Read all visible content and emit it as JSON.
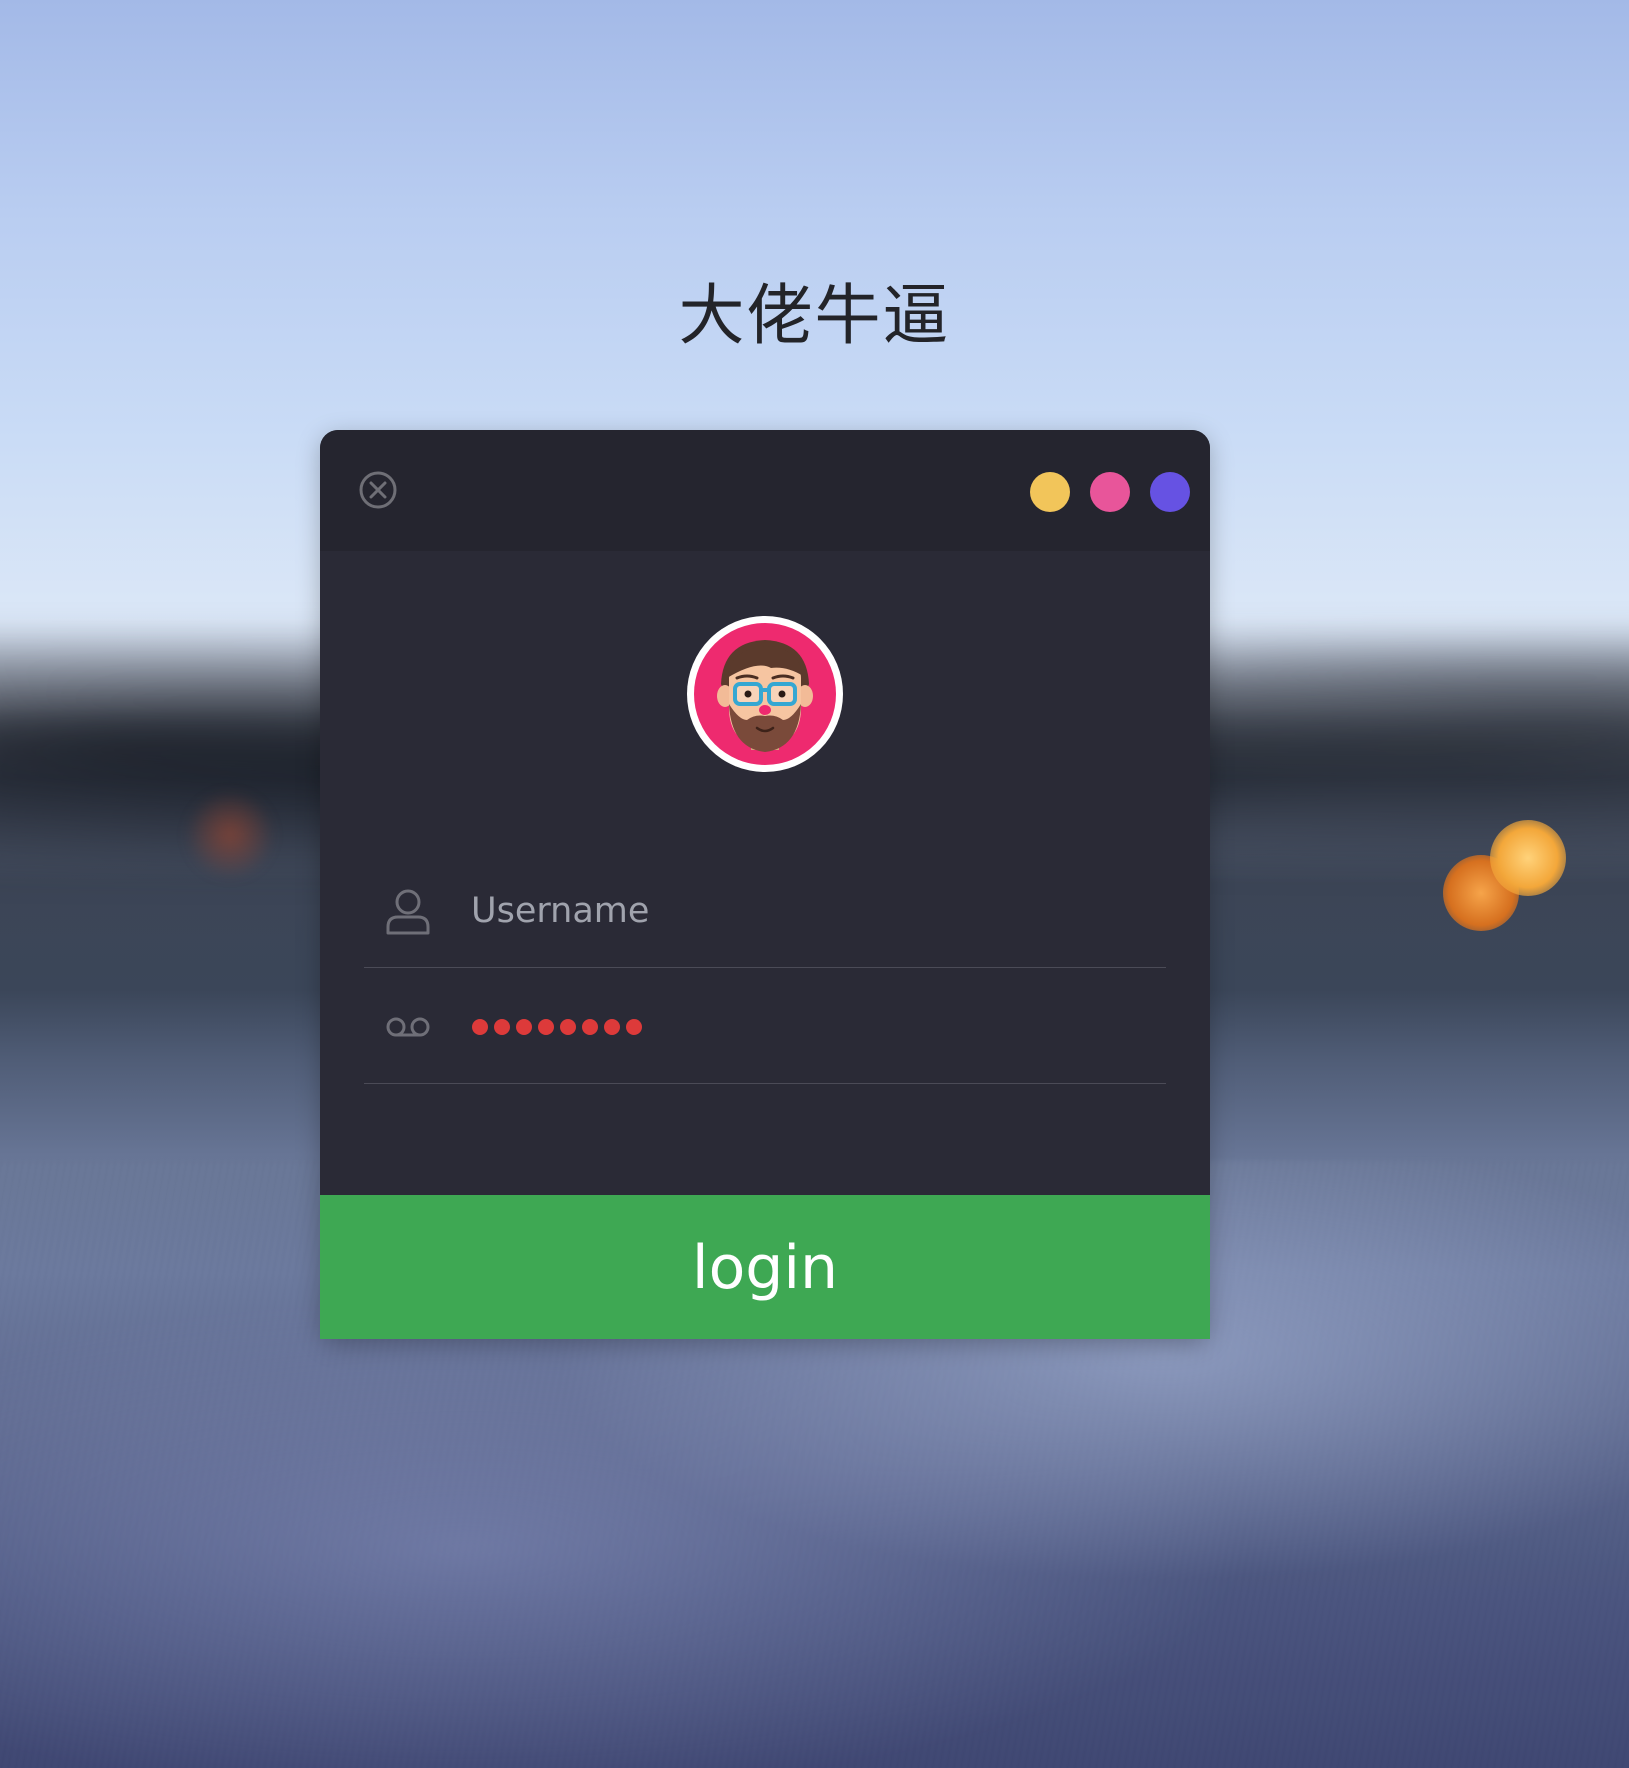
{
  "page": {
    "title": "大佬牛逼"
  },
  "card": {
    "header": {
      "close_icon": "close-circle-icon",
      "dots": [
        {
          "name": "yellow",
          "color": "#f2c55a"
        },
        {
          "name": "pink",
          "color": "#e8559a"
        },
        {
          "name": "purple",
          "color": "#6652e3"
        }
      ]
    },
    "avatar": {
      "icon": "bearded-man-avatar",
      "ring_color": "#ee2a6f"
    },
    "form": {
      "username": {
        "icon": "user-icon",
        "placeholder": "Username"
      },
      "password": {
        "icon": "voicemail-icon",
        "masked_length": 8,
        "dot_color": "#dd3a3a"
      }
    },
    "login_button": {
      "label": "login",
      "color": "#3ea853"
    }
  }
}
